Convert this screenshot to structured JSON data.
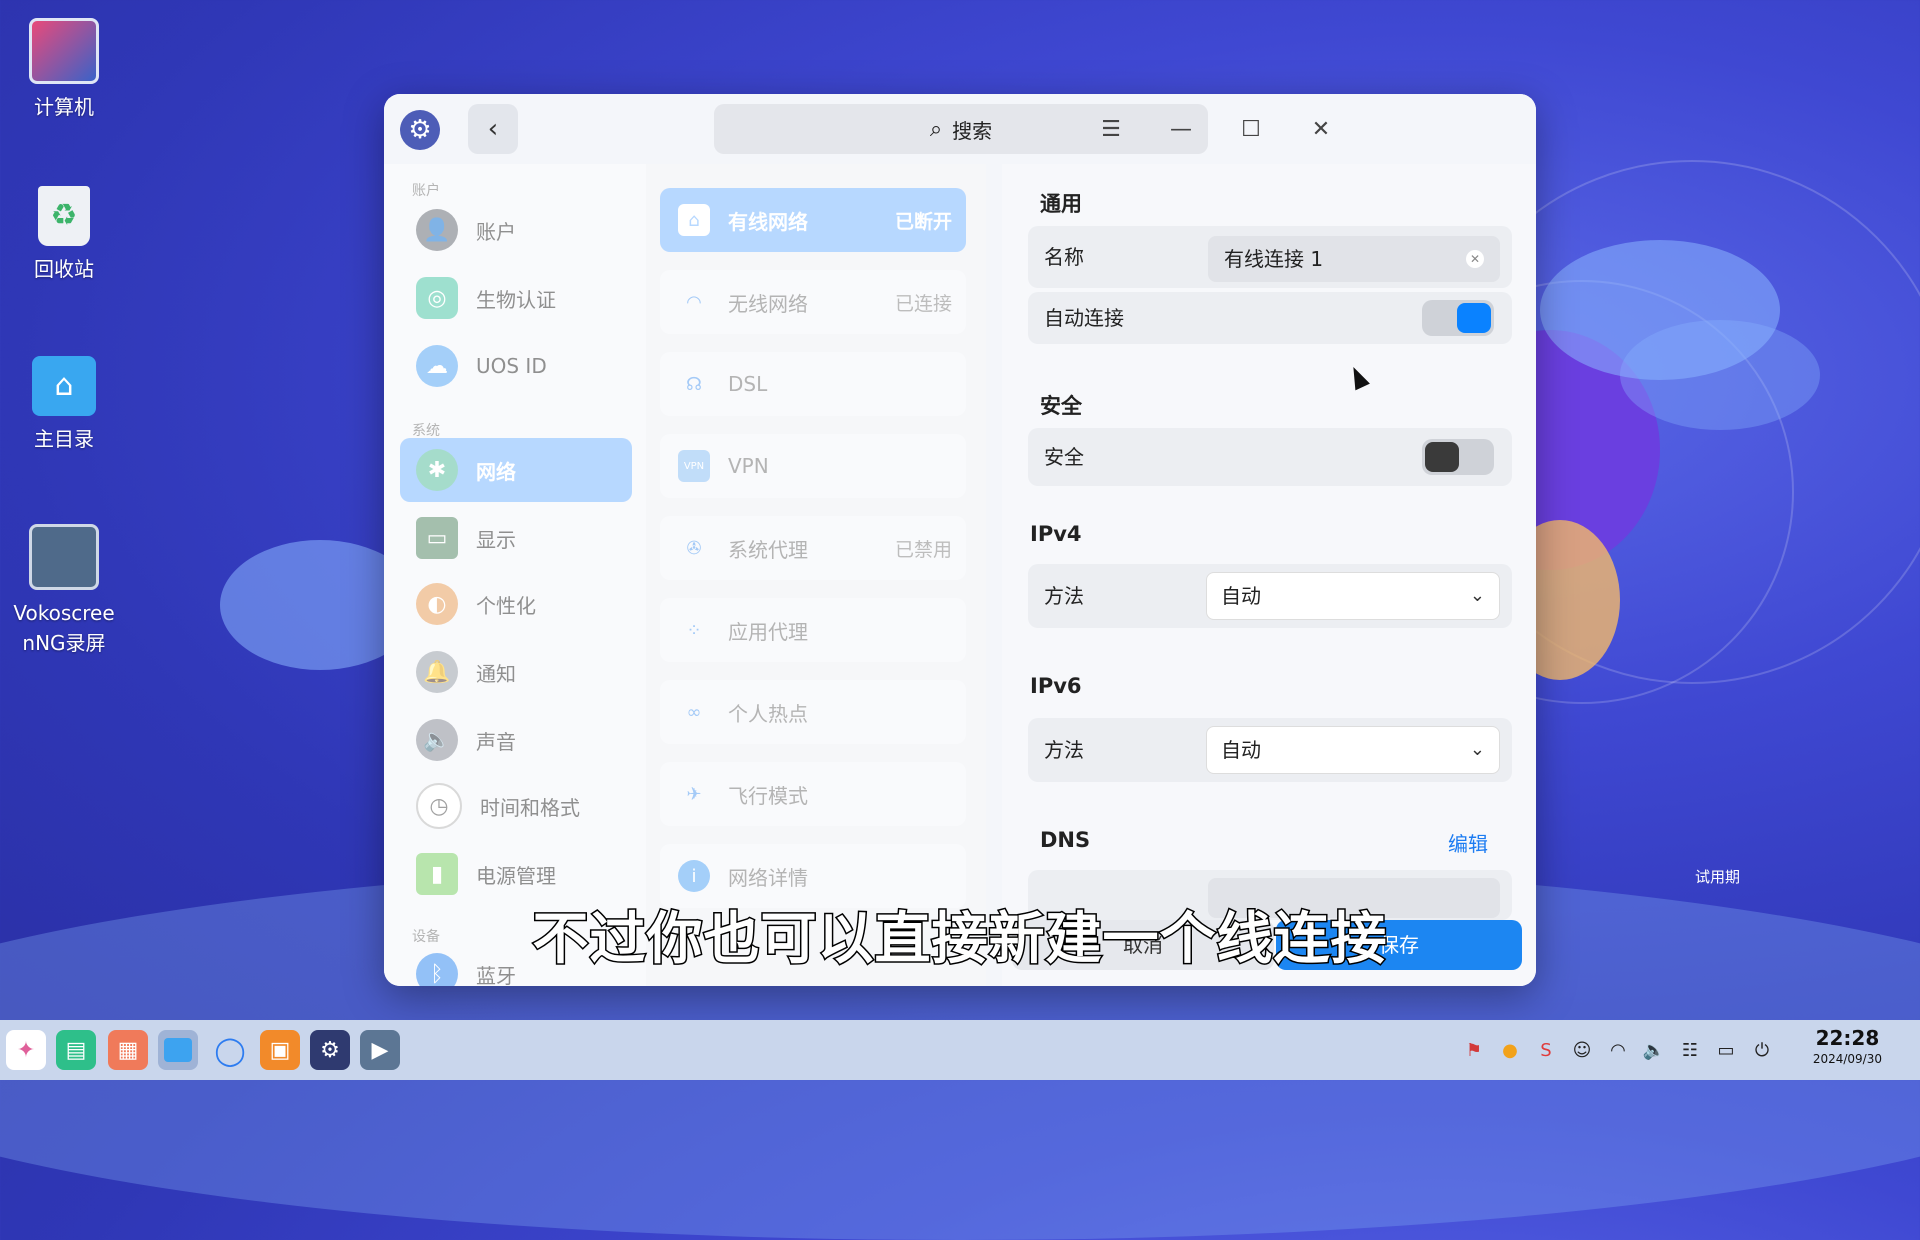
{
  "desktop": {
    "icons": [
      {
        "label": "计算机"
      },
      {
        "label": "回收站"
      },
      {
        "label": "主目录"
      },
      {
        "label": "Vokoscree nNG录屏"
      }
    ],
    "trial_label": "试用期"
  },
  "window": {
    "search_placeholder": "搜索"
  },
  "nav": {
    "section_account": "账户",
    "section_system": "系统",
    "section_device": "设备",
    "items": [
      {
        "label": "账户"
      },
      {
        "label": "生物认证"
      },
      {
        "label": "UOS ID"
      },
      {
        "label": "网络"
      },
      {
        "label": "显示"
      },
      {
        "label": "个性化"
      },
      {
        "label": "通知"
      },
      {
        "label": "声音"
      },
      {
        "label": "时间和格式"
      },
      {
        "label": "电源管理"
      },
      {
        "label": "蓝牙"
      }
    ]
  },
  "network_list": [
    {
      "label": "有线网络",
      "status": "已断开"
    },
    {
      "label": "无线网络",
      "status": "已连接"
    },
    {
      "label": "DSL",
      "status": ""
    },
    {
      "label": "VPN",
      "status": ""
    },
    {
      "label": "系统代理",
      "status": "已禁用"
    },
    {
      "label": "应用代理",
      "status": ""
    },
    {
      "label": "个人热点",
      "status": ""
    },
    {
      "label": "飞行模式",
      "status": ""
    },
    {
      "label": "网络详情",
      "status": ""
    }
  ],
  "detail": {
    "general_title": "通用",
    "name_label": "名称",
    "name_value": "有线连接 1",
    "auto_connect_label": "自动连接",
    "auto_connect_on": true,
    "security_title": "安全",
    "security_label": "安全",
    "security_on": false,
    "ipv4_title": "IPv4",
    "ipv4_method_label": "方法",
    "ipv4_method_value": "自动",
    "ipv6_title": "IPv6",
    "ipv6_method_label": "方法",
    "ipv6_method_value": "自动",
    "dns_title": "DNS",
    "dns_edit": "编辑",
    "cancel_label": "取消",
    "save_label": "保存"
  },
  "subtitle": "不过你也可以直接新建一个线连接",
  "taskbar": {
    "time": "22:28",
    "date": "2024/09/30"
  },
  "colors": {
    "accent": "#1c86f2",
    "nav_active": "#7db8ff",
    "desktop_bg": "#3f48d2"
  }
}
